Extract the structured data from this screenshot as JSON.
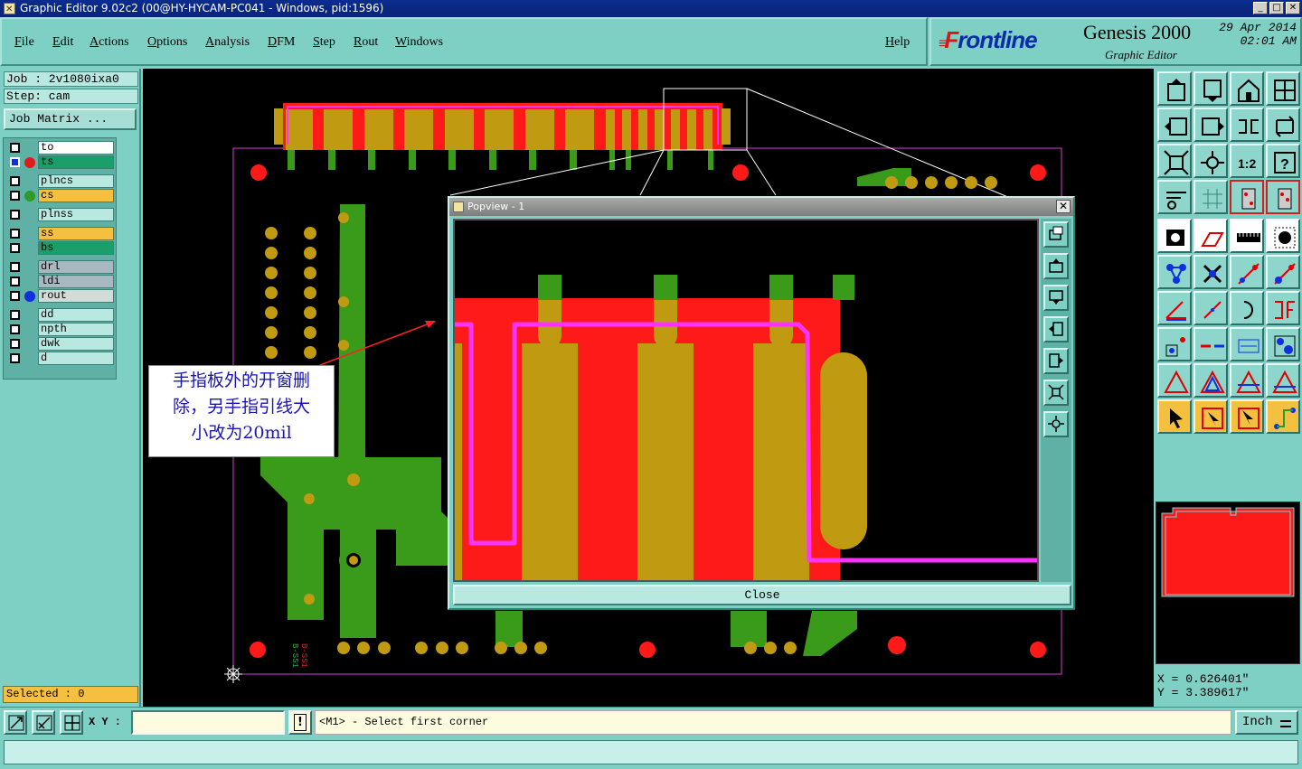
{
  "window": {
    "title": "Graphic Editor 9.02c2 (00@HY-HYCAM-PC041 - Windows, pid:1596)",
    "minimize_label": "_",
    "maximize_label": "□",
    "close_label": "✕"
  },
  "menu": {
    "file": "File",
    "edit": "Edit",
    "actions": "Actions",
    "options": "Options",
    "analysis": "Analysis",
    "dfm": "DFM",
    "step": "Step",
    "rout": "Rout",
    "windows": "Windows",
    "help": "Help"
  },
  "brand": {
    "logo_prefix": "F",
    "logo_rest": "rontline",
    "product": "Genesis 2000",
    "subtitle": "Graphic Editor",
    "date": "29 Apr 2014",
    "time": "02:01 AM"
  },
  "job": {
    "job_label": "Job : 2v1080ixa0",
    "step_label": "Step: cam",
    "job_matrix": "Job Matrix ..."
  },
  "layers": [
    {
      "name": "to",
      "color": "#ffffff",
      "dot": "",
      "checked": false
    },
    {
      "name": "ts",
      "color": "#1a9e6a",
      "dot": "#e01b1b",
      "checked": true
    },
    {
      "name": "plncs",
      "color": "#b8e8e0",
      "dot": "",
      "checked": false
    },
    {
      "name": "cs",
      "color": "#f5c040",
      "dot": "#2e9a2a",
      "checked": false
    },
    {
      "name": "plnss",
      "color": "#b8e8e0",
      "dot": "",
      "checked": false
    },
    {
      "name": "ss",
      "color": "#f5c040",
      "dot": "",
      "checked": false
    },
    {
      "name": "bs",
      "color": "#1a9e6a",
      "dot": "",
      "checked": false
    },
    {
      "name": "drl",
      "color": "#a8b8c0",
      "dot": "",
      "checked": false
    },
    {
      "name": "ldi",
      "color": "#a8b8c0",
      "dot": "",
      "checked": false
    },
    {
      "name": "rout",
      "color": "#d0dcd8",
      "dot": "#1030e0",
      "checked": false
    },
    {
      "name": "dd",
      "color": "#b8e8e0",
      "dot": "",
      "checked": false
    },
    {
      "name": "npth",
      "color": "#b8e8e0",
      "dot": "",
      "checked": false
    },
    {
      "name": "dwk",
      "color": "#b8e8e0",
      "dot": "",
      "checked": false
    },
    {
      "name": "d",
      "color": "#b8e8e0",
      "dot": "",
      "checked": false
    }
  ],
  "selected": "Selected : 0",
  "popview": {
    "title": "Popview - 1",
    "close_button": "Close",
    "close_x": "✕"
  },
  "annotation": {
    "line1": "手指板外的开窗删",
    "line2": "除，另手指引线大",
    "line3": "小改为20mil"
  },
  "board_text": "B-SS1",
  "coords": {
    "x": "X = 0.626401\"",
    "y": "Y = 3.389617\""
  },
  "bottom": {
    "xy_label": "X Y :",
    "xy_value": "",
    "warn": "!",
    "message": "<M1> - Select first corner",
    "unit": "Inch"
  },
  "colors": {
    "board_green": "#3a9a1a",
    "copper": "#c09a10",
    "mask_red": "#ff1a1a",
    "route_magenta": "#ff33ff",
    "panel_teal": "#7fd0c4"
  }
}
